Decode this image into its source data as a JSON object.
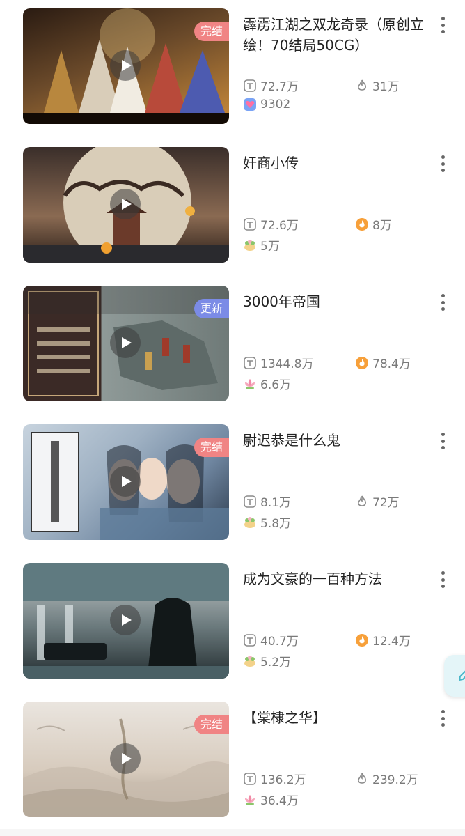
{
  "items": [
    {
      "title": "霹雳江湖之双龙奇录（原创立绘！70结局50CG）",
      "tag": "完结",
      "views": "72.7万",
      "stat2": "31万",
      "stat3": "9302",
      "icons": [
        "text-icon",
        "flame-icon",
        "heart-gift-icon"
      ],
      "thumb_colors": [
        "#2a1b12",
        "#6b4a2a",
        "#c98a3a"
      ]
    },
    {
      "title": "奸商小传",
      "tag": "",
      "views": "72.6万",
      "stat2": "8万",
      "stat3": "5万",
      "icons": [
        "text-icon",
        "fire-badge-icon",
        "flower-bun-icon"
      ],
      "thumb_colors": [
        "#3a2e2a",
        "#cfc3b0",
        "#8a6a52"
      ]
    },
    {
      "title": "3000年帝国",
      "tag": "更新",
      "views": "1344.8万",
      "stat2": "78.4万",
      "stat3": "6.6万",
      "icons": [
        "text-icon",
        "fire-badge-icon",
        "lotus-icon"
      ],
      "thumb_colors": [
        "#3b2a26",
        "#6f7a78",
        "#9aa3a2"
      ]
    },
    {
      "title": "尉迟恭是什么鬼",
      "tag": "完结",
      "views": "8.1万",
      "stat2": "72万",
      "stat3": "5.8万",
      "icons": [
        "text-icon",
        "flame-icon",
        "flower-bun-icon"
      ],
      "thumb_colors": [
        "#c7d3de",
        "#6f86a0",
        "#2c3a4c"
      ]
    },
    {
      "title": "成为文豪的一百种方法",
      "tag": "",
      "views": "40.7万",
      "stat2": "12.4万",
      "stat3": "5.2万",
      "icons": [
        "text-icon",
        "fire-badge-icon",
        "flower-bun-icon"
      ],
      "thumb_colors": [
        "#5f7a80",
        "#1f2a2d",
        "#c9d5d6"
      ]
    },
    {
      "title": "【棠棣之华】",
      "tag": "完结",
      "views": "136.2万",
      "stat2": "239.2万",
      "stat3": "36.4万",
      "icons": [
        "text-icon",
        "flame-icon",
        "lotus-icon"
      ],
      "thumb_colors": [
        "#eae5df",
        "#d7cbbd",
        "#a89b8d"
      ]
    }
  ],
  "colors": {
    "tag_done": "#f08484",
    "tag_update": "#7b8be6",
    "stat_text": "#7a7a7a",
    "title_text": "#222222"
  },
  "fab": {
    "icon": "pencil-icon"
  }
}
